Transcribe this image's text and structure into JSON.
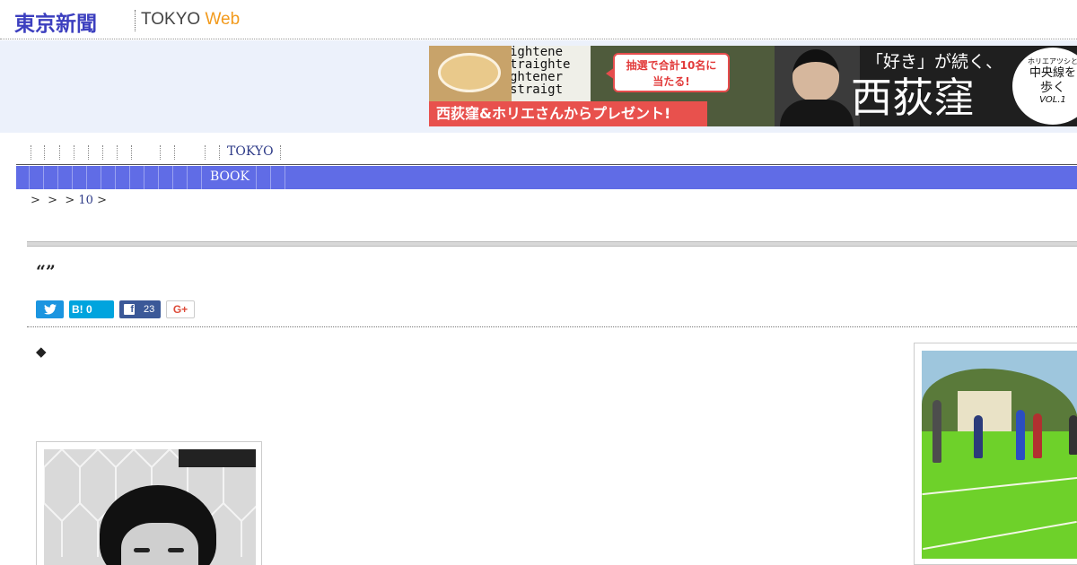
{
  "header": {
    "logo_jp": "東京新聞",
    "logo_en": "TOKYO",
    "logo_web": "Web"
  },
  "ad": {
    "bubble_line1": "抽選で合計10名に",
    "bubble_line2": "当たる!",
    "red_bar": "西荻窪&ホリエさんからプレゼント!",
    "catch": "「好き」が続く、",
    "title": "西荻窪",
    "circle_line1": "ホリエアツシと",
    "circle_line2": "中央線を",
    "circle_line3": "歩く",
    "circle_line4": "VOL.1",
    "words": [
      "ightene",
      "traighte",
      "ghtener",
      "straigt"
    ]
  },
  "nav": {
    "tokyo_label": "TOKYO",
    "book_label": "BOOK"
  },
  "breadcrumb": {
    "sep1": ">",
    "sep2": ">",
    "sep3": ">",
    "link": "10",
    "sep4": ">"
  },
  "article": {
    "title": "“”",
    "marker": "◆"
  },
  "share": {
    "hatena_label": "B!",
    "hatena_count": "0",
    "facebook_count": "23",
    "gplus_label": "G+"
  },
  "colors": {
    "brand": "#3c3fbf",
    "nav_blue": "#606ce6",
    "web_orange": "#f29a1c",
    "ad_red": "#e8514d",
    "twitter": "#1b95e0",
    "hatena": "#00a4de",
    "facebook": "#3b5998"
  }
}
